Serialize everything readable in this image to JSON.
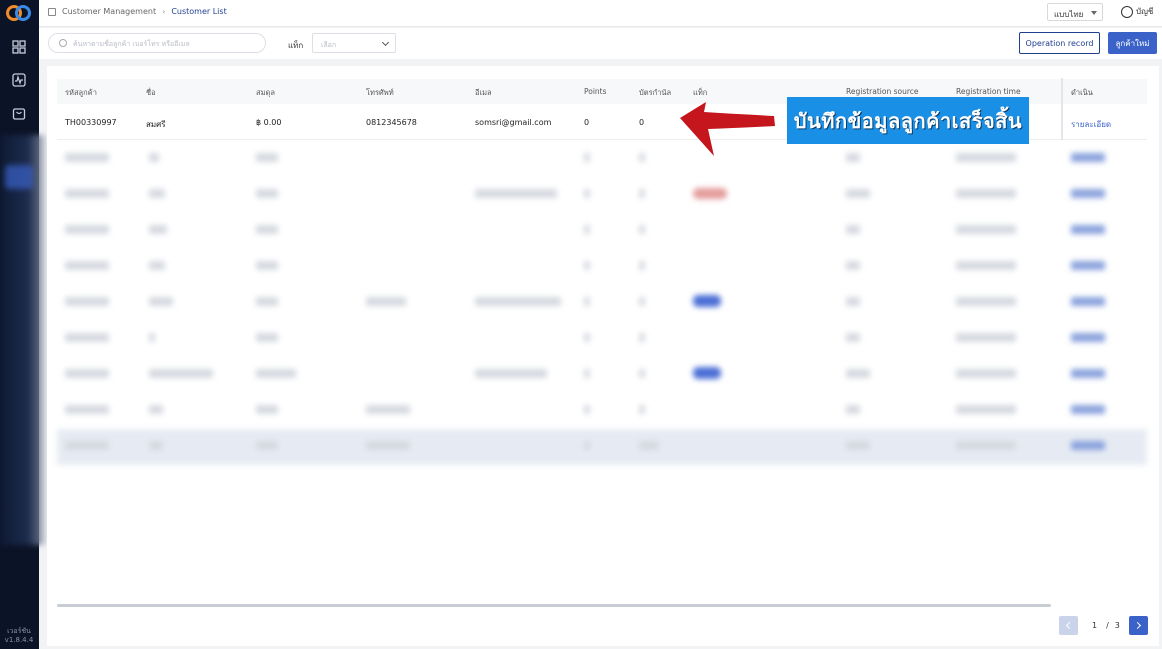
{
  "app": {
    "version": "เวอร์ชัน\nv1.8.4.4"
  },
  "breadcrumb": {
    "parent": "Customer Management",
    "current": "Customer List"
  },
  "header": {
    "language": "แบบไทย",
    "account": "บัญชี"
  },
  "filters": {
    "search_placeholder": "ค้นหาตามชื่อลูกค้า เบอร์โทร หรืออีเมล",
    "tag_label": "แท็ก",
    "tag_placeholder": "เลือก"
  },
  "actions": {
    "operation_record": "Operation record",
    "new_customer": "ลูกค้าใหม่"
  },
  "table": {
    "columns": [
      "รหัสลูกค้า",
      "ชื่อ",
      "สมดุล",
      "โทรศัพท์",
      "อีเมล",
      "Points",
      "บัตรกำนัล",
      "แท็ก",
      "Registration source",
      "Registration time",
      "ดำเนิน"
    ],
    "rows": [
      {
        "id": "TH00330997",
        "name": "สมศรี",
        "balance": "฿ 0.00",
        "phone": "0812345678",
        "email": "somsri@gmail.com",
        "points": "0",
        "vouchers": "0",
        "action": "รายละเอียด"
      }
    ]
  },
  "pagination": {
    "current": "1",
    "separator": "/",
    "total": "3"
  },
  "annotation": {
    "banner_text": "บันทึกข้อมูลลูกค้าเสร็จสิ้น",
    "arrow_color": "#c4161c",
    "banner_color": "#1a8fe6"
  },
  "colors": {
    "primary": "#3a62c9",
    "sidebar": "#0b1326",
    "link": "#1f3f8f"
  }
}
